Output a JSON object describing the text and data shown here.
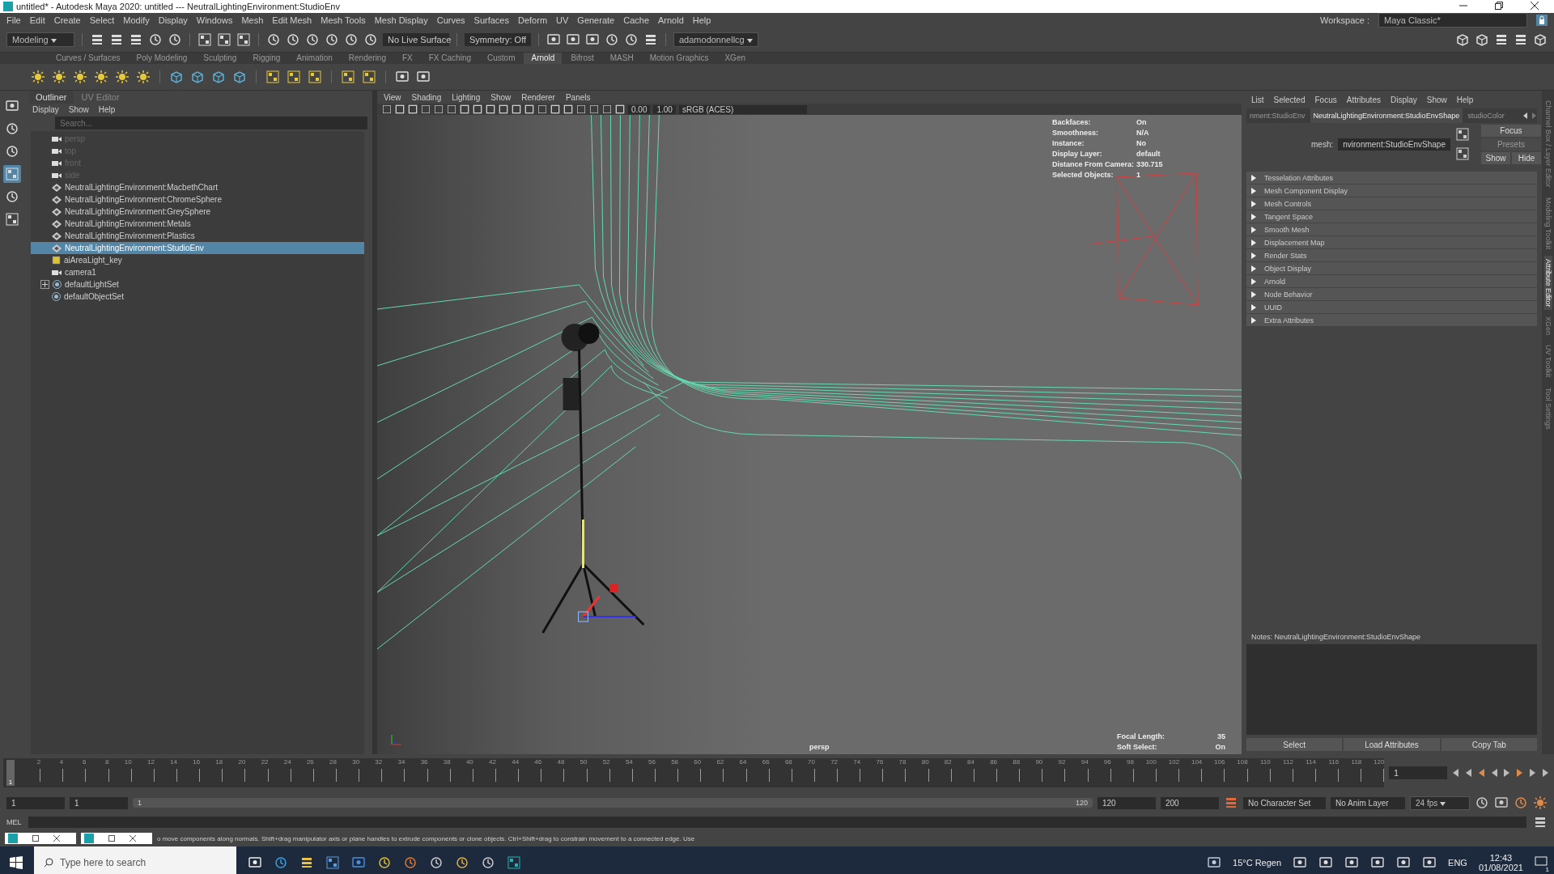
{
  "window": {
    "title": "untitled* - Autodesk Maya 2020: untitled   ---   NeutralLightingEnvironment:StudioEnv"
  },
  "menu": [
    "File",
    "Edit",
    "Create",
    "Select",
    "Modify",
    "Display",
    "Windows",
    "Mesh",
    "Edit Mesh",
    "Mesh Tools",
    "Mesh Display",
    "Curves",
    "Surfaces",
    "Deform",
    "UV",
    "Generate",
    "Cache",
    "Arnold",
    "Help"
  ],
  "status_line": {
    "mode": "Modeling",
    "live_surface": "No Live Surface",
    "symmetry": "Symmetry: Off",
    "user": "adamodonnellcg",
    "workspace_label": "Workspace :",
    "workspace": "Maya Classic*"
  },
  "shelf": {
    "tabs": [
      {
        "label": "Curves / Surfaces",
        "selected": false
      },
      {
        "label": "Poly Modeling",
        "selected": false
      },
      {
        "label": "Sculpting",
        "selected": false
      },
      {
        "label": "Rigging",
        "selected": false
      },
      {
        "label": "Animation",
        "selected": false
      },
      {
        "label": "Rendering",
        "selected": false
      },
      {
        "label": "FX",
        "selected": false
      },
      {
        "label": "FX Caching",
        "selected": false
      },
      {
        "label": "Custom",
        "selected": false
      },
      {
        "label": "Arnold",
        "selected": true
      },
      {
        "label": "Bifrost",
        "selected": false
      },
      {
        "label": "MASH",
        "selected": false
      },
      {
        "label": "Motion Graphics",
        "selected": false
      },
      {
        "label": "XGen",
        "selected": false
      }
    ]
  },
  "outliner": {
    "tabs": [
      {
        "label": "Outliner",
        "selected": true
      },
      {
        "label": "UV Editor",
        "selected": false
      }
    ],
    "menu": [
      "Display",
      "Show",
      "Help"
    ],
    "search": {
      "placeholder": "Search..."
    },
    "items": [
      {
        "kind": "camera",
        "label": "persp",
        "hidden": true,
        "selected": false
      },
      {
        "kind": "camera",
        "label": "top",
        "hidden": true,
        "selected": false
      },
      {
        "kind": "camera",
        "label": "front",
        "hidden": true,
        "selected": false
      },
      {
        "kind": "camera",
        "label": "side",
        "hidden": true,
        "selected": false
      },
      {
        "kind": "group",
        "label": "NeutralLightingEnvironment:MacbethChart",
        "hidden": false,
        "selected": false
      },
      {
        "kind": "group",
        "label": "NeutralLightingEnvironment:ChromeSphere",
        "hidden": false,
        "selected": false
      },
      {
        "kind": "group",
        "label": "NeutralLightingEnvironment:GreySphere",
        "hidden": false,
        "selected": false
      },
      {
        "kind": "group",
        "label": "NeutralLightingEnvironment:Metals",
        "hidden": false,
        "selected": false
      },
      {
        "kind": "group",
        "label": "NeutralLightingEnvironment:Plastics",
        "hidden": false,
        "selected": false
      },
      {
        "kind": "group",
        "label": "NeutralLightingEnvironment:StudioEnv",
        "hidden": false,
        "selected": true
      },
      {
        "kind": "light",
        "label": "aiAreaLight_key",
        "hidden": false,
        "selected": false
      },
      {
        "kind": "camera",
        "label": "camera1",
        "hidden": false,
        "selected": false
      },
      {
        "kind": "set",
        "label": "defaultLightSet",
        "hidden": false,
        "selected": false,
        "expanded": false
      },
      {
        "kind": "set",
        "label": "defaultObjectSet",
        "hidden": false,
        "selected": false
      }
    ]
  },
  "viewport": {
    "menu": [
      "View",
      "Shading",
      "Lighting",
      "Show",
      "Renderer",
      "Panels"
    ],
    "exposure": "0.00",
    "gamma": "1.00",
    "color_space": "sRGB (ACES)",
    "hud": [
      {
        "label": "Backfaces:",
        "value": "On"
      },
      {
        "label": "Smoothness:",
        "value": "N/A"
      },
      {
        "label": "Instance:",
        "value": "No"
      },
      {
        "label": "Display Layer:",
        "value": "default"
      },
      {
        "label": "Distance From Camera:",
        "value": "330.715"
      },
      {
        "label": "Selected Objects:",
        "value": "1"
      }
    ],
    "hud_bottom": [
      {
        "label": "Focal Length:",
        "value": "35"
      },
      {
        "label": "Soft Select:",
        "value": "On"
      }
    ],
    "camera": "persp"
  },
  "attribute_editor": {
    "menu": [
      "List",
      "Selected",
      "Focus",
      "Attributes",
      "Display",
      "Show",
      "Help"
    ],
    "tabs": [
      {
        "label": "nment:StudioEnv",
        "selected": false
      },
      {
        "label": "NeutralLightingEnvironment:StudioEnvShape",
        "selected": true
      },
      {
        "label": "studioColor",
        "selected": false
      }
    ],
    "node_label": "mesh:",
    "node_value": "nvironment:StudioEnvShape",
    "side_buttons": [
      {
        "label": "Focus",
        "disabled": false
      },
      {
        "label": "Presets",
        "disabled": true
      },
      {
        "label": "Show",
        "disabled": false
      },
      {
        "label": "Hide",
        "disabled": false
      }
    ],
    "sections": [
      "Tesselation Attributes",
      "Mesh Component Display",
      "Mesh Controls",
      "Tangent Space",
      "Smooth Mesh",
      "Displacement Map",
      "Render Stats",
      "Object Display",
      "Arnold",
      "Node Behavior",
      "UUID",
      "Extra Attributes"
    ],
    "notes": "Notes:  NeutralLightingEnvironment:StudioEnvShape",
    "buttons": [
      "Select",
      "Load Attributes",
      "Copy Tab"
    ]
  },
  "side_tabs": [
    {
      "label": "Channel Box / Layer Editor",
      "selected": false
    },
    {
      "label": "Modeling Toolkit",
      "selected": false
    },
    {
      "label": "Attribute Editor",
      "selected": true
    },
    {
      "label": "XGen",
      "selected": false
    },
    {
      "label": "UV Toolkit",
      "selected": false
    },
    {
      "label": "Tool Settings",
      "selected": false
    }
  ],
  "time_slider": {
    "ticks": [
      "2",
      "4",
      "6",
      "8",
      "10",
      "12",
      "14",
      "16",
      "18",
      "20",
      "22",
      "24",
      "26",
      "28",
      "30",
      "32",
      "34",
      "36",
      "38",
      "40",
      "42",
      "44",
      "46",
      "48",
      "50",
      "52",
      "54",
      "56",
      "58",
      "60",
      "62",
      "64",
      "66",
      "68",
      "70",
      "72",
      "74",
      "76",
      "78",
      "80",
      "82",
      "84",
      "86",
      "88",
      "90",
      "92",
      "94",
      "96",
      "98",
      "100",
      "102",
      "104",
      "106",
      "108",
      "110",
      "112",
      "114",
      "116",
      "118",
      "120"
    ],
    "current": "1",
    "current_field": "1",
    "level": 0
  },
  "range_slider": {
    "level": 1,
    "start": "1",
    "anim_start": "1",
    "range_start": "1",
    "range_end": "120",
    "anim_end": "120",
    "end": "200",
    "character_set": "No Character Set",
    "anim_layer": "No Anim Layer",
    "fps": "24 fps"
  },
  "command_line": {
    "label": "MEL"
  },
  "help_line": "o move components along normals. Shift+drag manipulator axis or plane handles to extrude components or clone objects. Ctrl+Shift+drag to constrain movement to a connected edge. Use",
  "taskbar": {
    "search_placeholder": "Type here to search",
    "weather": "15°C  Regen",
    "language": "ENG",
    "time": "12:43",
    "date": "01/08/2021",
    "notifications": "1"
  }
}
